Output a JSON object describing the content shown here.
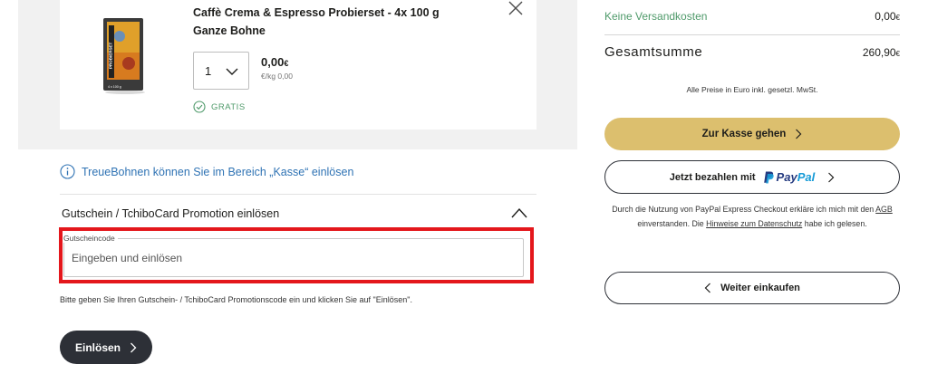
{
  "cart_item": {
    "title": "Caffè Crema & Espresso Probierset - 4x 100 g Ganze Bohne",
    "image_label": "PROBIERSET",
    "image_sublabel": "4 x 100 g",
    "quantity": "1",
    "price": "0,00",
    "price_currency": "€",
    "price_per_kg": "€/kg 0,00",
    "free_label": "GRATIS"
  },
  "treue": {
    "text": "TreueBohnen können Sie im Bereich „Kasse“ einlösen"
  },
  "voucher": {
    "heading": "Gutschein / TchiboCard Promotion einlösen",
    "field_label": "Gutscheincode",
    "field_placeholder": "Eingeben und einlösen",
    "field_value": "",
    "hint": "Bitte geben Sie Ihren Gutschein- / TchiboCard Promotionscode ein und klicken Sie auf \"Einlösen\".",
    "button_label": "Einlösen"
  },
  "summary": {
    "shipping_label": "Keine Versandkosten",
    "shipping_value": "0,00",
    "total_label": "Gesamtsumme",
    "total_value": "260,90",
    "currency": "€",
    "vat_note": "Alle Preise in Euro inkl. gesetzl. MwSt."
  },
  "checkout": {
    "kasse_label": "Zur Kasse gehen",
    "paypal_prefix": "Jetzt bezahlen mit",
    "paypal_pay": "Pay",
    "paypal_pal": "Pal",
    "legal_part1": "Durch die Nutzung von PayPal Express Checkout erkläre ich mich mit den",
    "legal_link_agb": "AGB",
    "legal_part2": "einverstanden. Die",
    "legal_link_privacy": "Hinweise zum Datenschutz",
    "legal_part3": "habe ich gelesen.",
    "continue_label": "Weiter einkaufen"
  },
  "colors": {
    "accent_gold": "#dcbf6e",
    "green": "#4f9a6a",
    "link_blue": "#2f73b4",
    "highlight_red": "#e4171c",
    "dark": "#2d3037"
  }
}
